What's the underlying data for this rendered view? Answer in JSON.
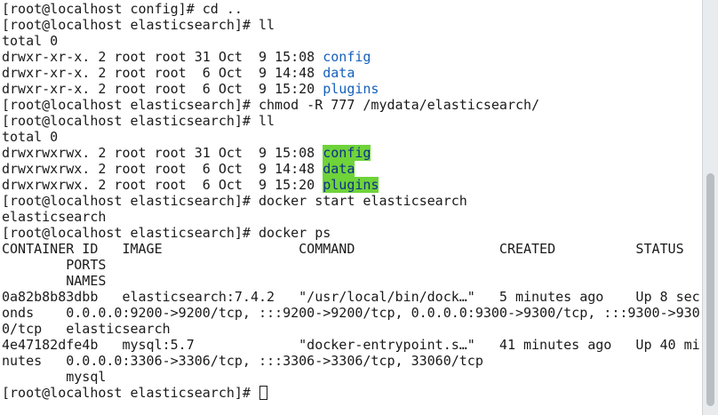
{
  "terminal": {
    "prompt": "[root@localhost elasticsearch]# ",
    "lines": [
      [
        {
          "t": "[root@localhost config]# cd .."
        }
      ],
      [
        {
          "t": "[root@localhost elasticsearch]# ll"
        }
      ],
      [
        {
          "t": "total 0"
        }
      ],
      [
        {
          "t": "drwxr-xr-x. 2 root root 31 Oct  9 15:08 "
        },
        {
          "t": "config",
          "c": "blue"
        }
      ],
      [
        {
          "t": "drwxr-xr-x. 2 root root  6 Oct  9 14:48 "
        },
        {
          "t": "data",
          "c": "blue"
        }
      ],
      [
        {
          "t": "drwxr-xr-x. 2 root root  6 Oct  9 15:20 "
        },
        {
          "t": "plugins",
          "c": "blue"
        }
      ],
      [
        {
          "t": "[root@localhost elasticsearch]# chmod -R 777 /mydata/elasticsearch/"
        }
      ],
      [
        {
          "t": "[root@localhost elasticsearch]# ll"
        }
      ],
      [
        {
          "t": "total 0"
        }
      ],
      [
        {
          "t": "drwxrwxrwx. 2 root root 31 Oct  9 15:08 "
        },
        {
          "t": "config",
          "c": "hl"
        }
      ],
      [
        {
          "t": "drwxrwxrwx. 2 root root  6 Oct  9 14:48 "
        },
        {
          "t": "data",
          "c": "hl"
        }
      ],
      [
        {
          "t": "drwxrwxrwx. 2 root root  6 Oct  9 15:20 "
        },
        {
          "t": "plugins",
          "c": "hl"
        }
      ],
      [
        {
          "t": "[root@localhost elasticsearch]# docker start elasticsearch"
        }
      ],
      [
        {
          "t": "elasticsearch"
        }
      ],
      [
        {
          "t": "[root@localhost elasticsearch]# docker ps"
        }
      ],
      [
        {
          "t": "CONTAINER ID   IMAGE                 COMMAND                  CREATED          STATUS"
        }
      ],
      [
        {
          "t": "        PORTS"
        }
      ],
      [
        {
          "t": "        NAMES"
        }
      ],
      [
        {
          "t": "0a82b8b83dbb   elasticsearch:7.4.2   \"/usr/local/bin/dock…\"   5 minutes ago    Up 8 sec"
        }
      ],
      [
        {
          "t": "onds    0.0.0.0:9200->9200/tcp, :::9200->9200/tcp, 0.0.0.0:9300->9300/tcp, :::9300->930"
        }
      ],
      [
        {
          "t": "0/tcp   elasticsearch"
        }
      ],
      [
        {
          "t": "4e47182dfe4b   mysql:5.7             \"docker-entrypoint.s…\"   41 minutes ago   Up 40 mi"
        }
      ],
      [
        {
          "t": "nutes   0.0.0.0:3306->3306/tcp, :::3306->3306/tcp, 33060/tcp"
        }
      ],
      [
        {
          "t": "        mysql"
        }
      ]
    ]
  },
  "colors": {
    "link": "#1560bd",
    "highlight_bg": "#6fd33a",
    "highlight_fg": "#0d2f8a"
  }
}
